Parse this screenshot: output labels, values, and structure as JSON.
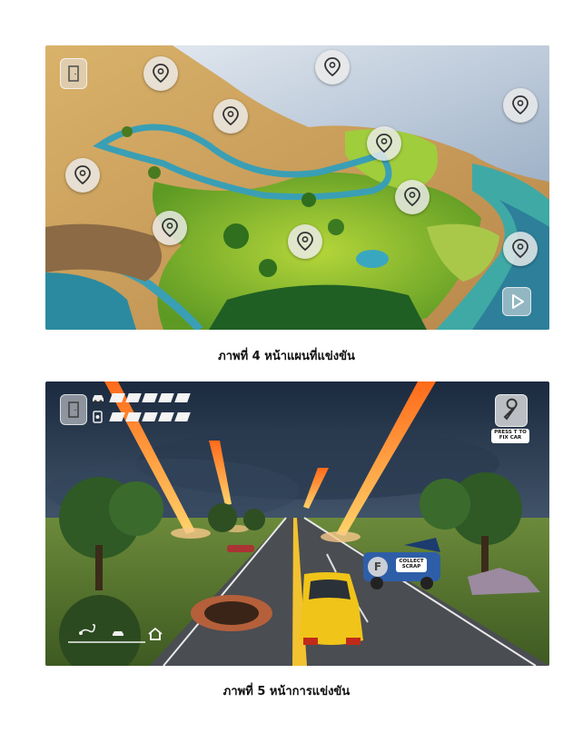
{
  "figures": [
    {
      "caption": "ภาพที่ 4 หน้าแผนที่แข่งขัน",
      "map_pins": [
        "location-pin",
        "location-pin",
        "location-pin",
        "location-pin",
        "location-pin",
        "location-pin",
        "location-pin",
        "location-pin",
        "location-pin"
      ],
      "icons": [
        "exit-door-icon",
        "play-icon"
      ]
    },
    {
      "caption": "ภาพที่ 5 หน้าการแข่งขัน",
      "hud": {
        "car_health_bars": 5,
        "fuel_bars": 5,
        "fix_car_label": "PRESS T TO FIX CAR",
        "collect_scrap_label": "COLLECT SCRAP",
        "collect_key": "F"
      },
      "icons": [
        "exit-door-icon",
        "car-icon",
        "fuel-icon",
        "wrench-icon",
        "scorpion-icon",
        "home-icon"
      ]
    }
  ]
}
